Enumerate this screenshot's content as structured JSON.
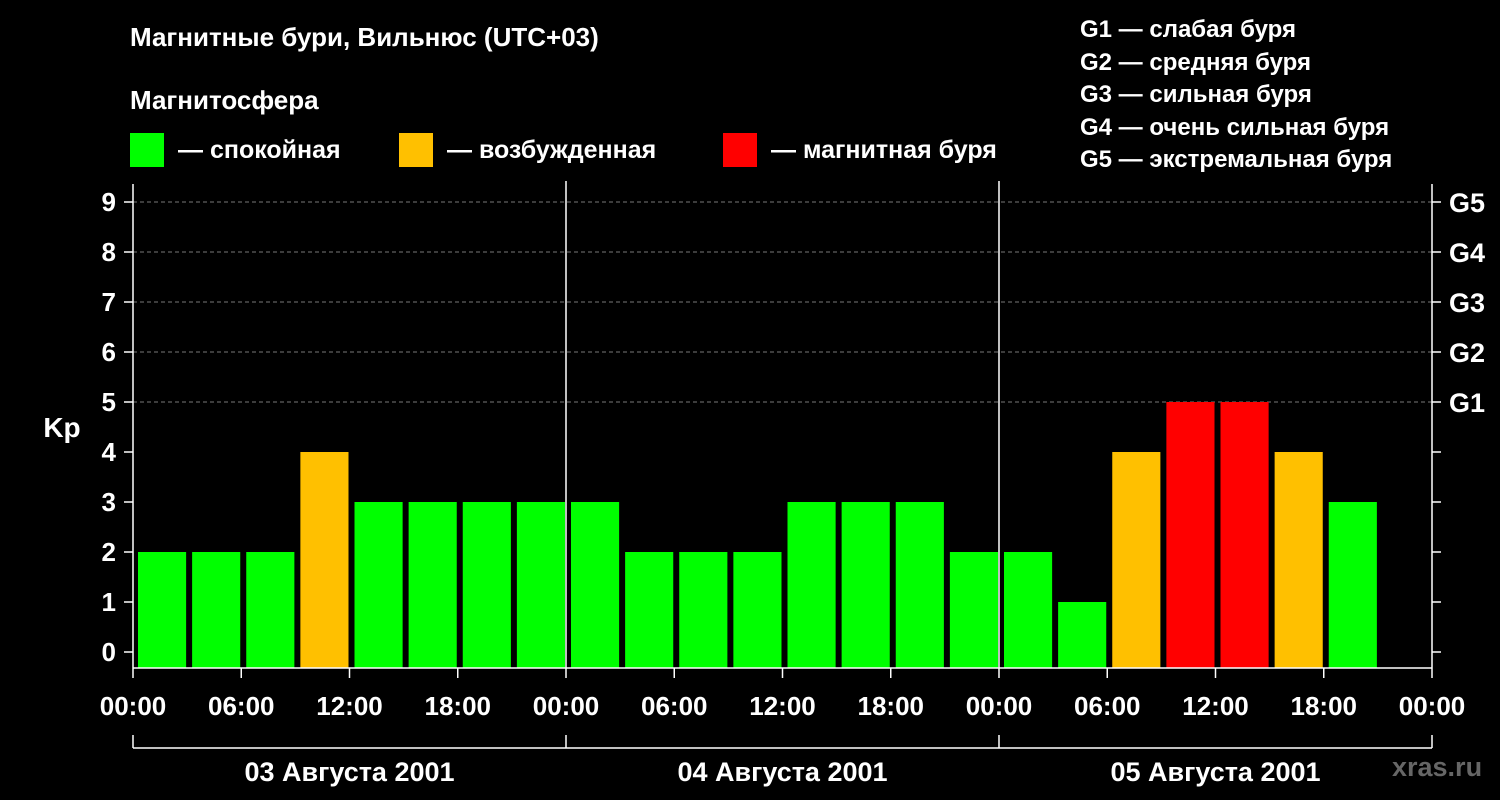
{
  "title": "Магнитные бури, Вильнюс (UTC+03)",
  "magnetosphere": {
    "title": "Магнитосфера",
    "legend": [
      {
        "label": "— спокойная",
        "color": "#00ff00"
      },
      {
        "label": "— возбужденная",
        "color": "#ffc000"
      },
      {
        "label": "— магнитная буря",
        "color": "#ff0000"
      }
    ]
  },
  "storm_scale": [
    "G1 — слабая буря",
    "G2 — средняя буря",
    "G3 — сильная буря",
    "G4 — очень сильная буря",
    "G5 — экстремальная буря"
  ],
  "watermark": "xras.ru",
  "chart_data": {
    "type": "bar",
    "ylabel": "Kp",
    "ylim": [
      0,
      9
    ],
    "y_ticks": [
      0,
      1,
      2,
      3,
      4,
      5,
      6,
      7,
      8,
      9
    ],
    "right_axis_labels": [
      {
        "kp": 5,
        "label": "G1"
      },
      {
        "kp": 6,
        "label": "G2"
      },
      {
        "kp": 7,
        "label": "G3"
      },
      {
        "kp": 8,
        "label": "G4"
      },
      {
        "kp": 9,
        "label": "G5"
      }
    ],
    "x_tick_labels": [
      "00:00",
      "06:00",
      "12:00",
      "18:00",
      "00:00",
      "06:00",
      "12:00",
      "18:00",
      "00:00",
      "06:00",
      "12:00",
      "18:00",
      "00:00"
    ],
    "days": [
      "03 Августа 2001",
      "04 Августа 2001",
      "05 Августа 2001"
    ],
    "interval_hours": 3,
    "values": [
      2,
      2,
      2,
      4,
      3,
      3,
      3,
      3,
      3,
      2,
      2,
      2,
      3,
      3,
      3,
      2,
      2,
      1,
      4,
      5,
      5,
      4,
      3
    ],
    "colors": {
      "calm": "#00ff00",
      "active": "#ffc000",
      "storm": "#ff0000"
    },
    "grid": true
  }
}
